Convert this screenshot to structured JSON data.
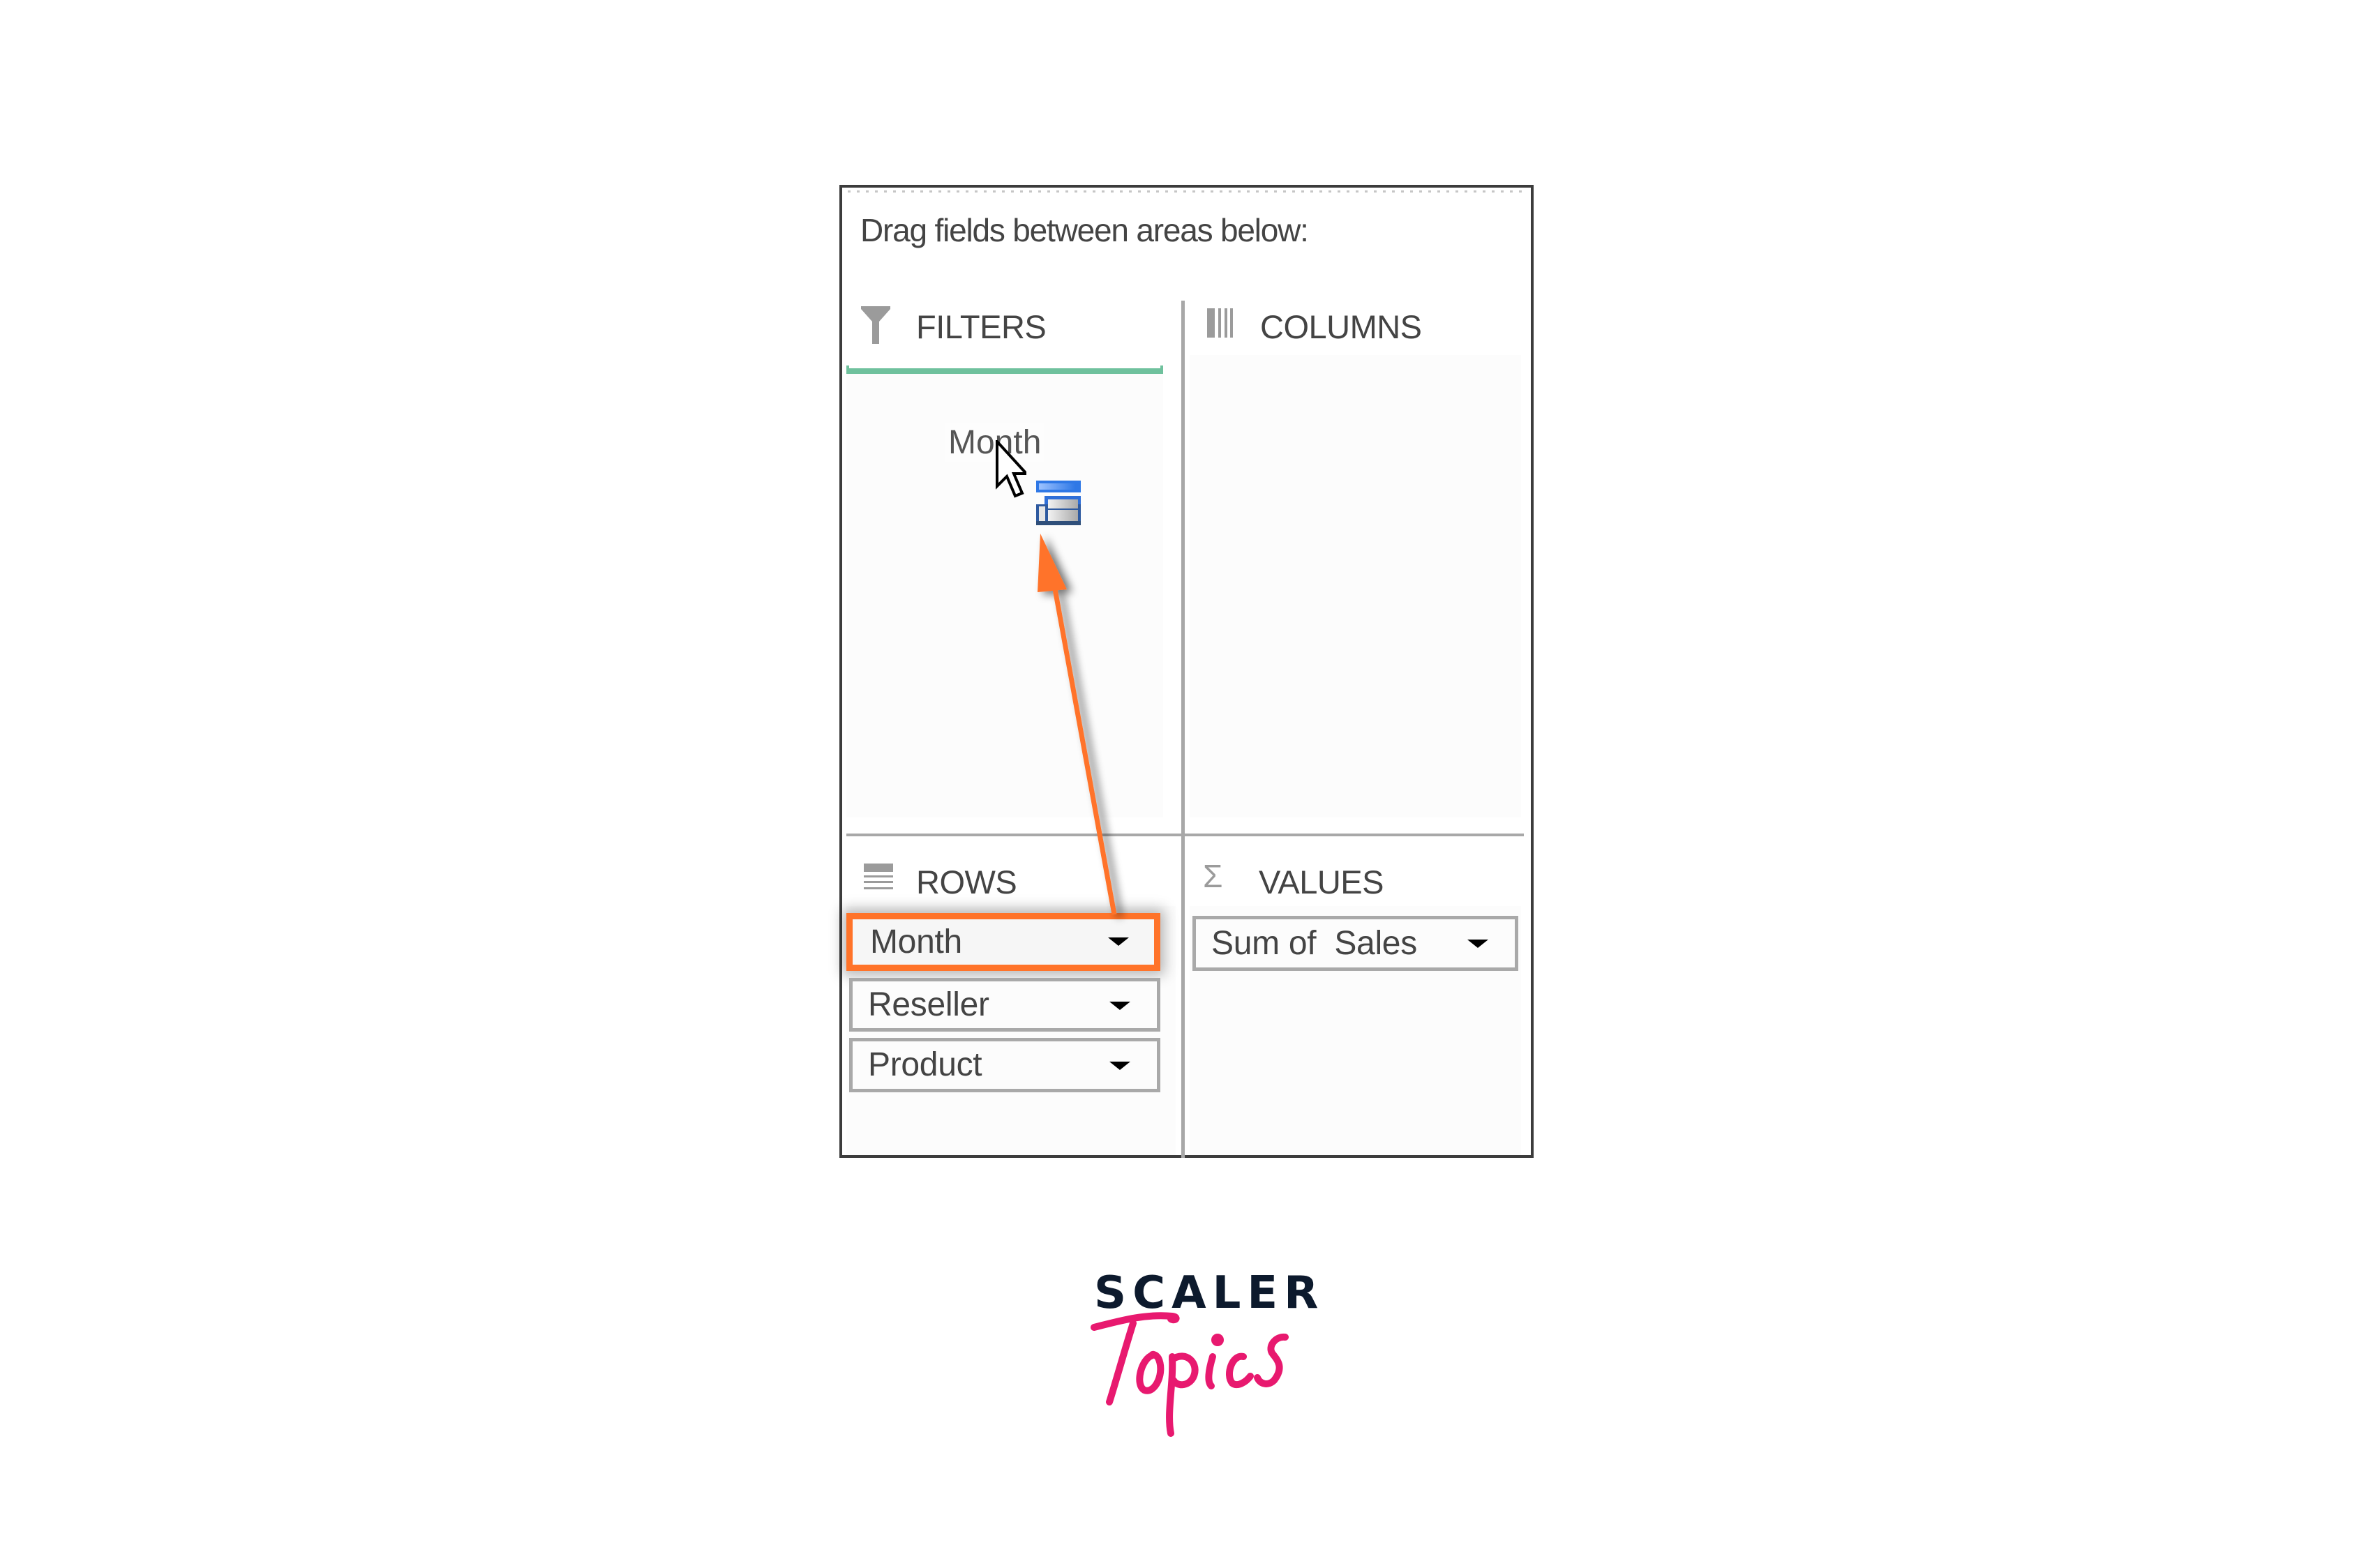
{
  "panel": {
    "instruction": "Drag fields between areas below:",
    "areas": {
      "filters": {
        "label": "FILTERS",
        "icon": "funnel-icon",
        "drop_highlight_color": "#6fc19d"
      },
      "columns": {
        "label": "COLUMNS",
        "icon": "columns-icon"
      },
      "rows": {
        "label": "ROWS",
        "icon": "rows-icon",
        "fields": [
          {
            "label": "Month",
            "highlighted": true
          },
          {
            "label": "Reseller",
            "highlighted": false
          },
          {
            "label": "Product",
            "highlighted": false
          }
        ]
      },
      "values": {
        "label": "VALUES",
        "icon": "sigma-icon",
        "fields": [
          {
            "label": "Sum of  Sales"
          }
        ]
      }
    },
    "dragging": {
      "label": "Month",
      "cursor": "arrow-cursor-icon",
      "drag_icon": "field-drag-icon"
    },
    "annotation": {
      "color": "#ff7329",
      "from": "rows.fields.0",
      "to": "filters"
    }
  },
  "logo": {
    "top": "SCALER",
    "script": "Topics",
    "top_color": "#0d1a2d",
    "script_color": "#e8196f"
  }
}
